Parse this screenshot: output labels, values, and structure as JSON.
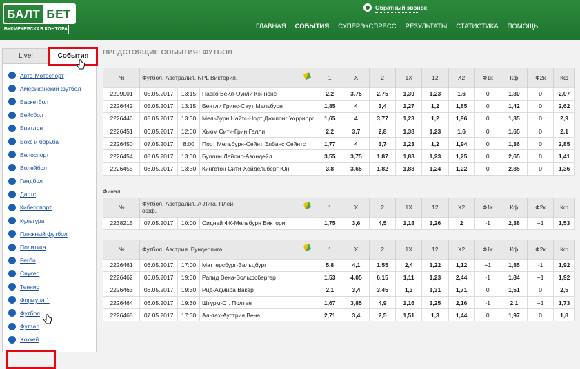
{
  "brand": {
    "logo_left": "БАЛТ",
    "logo_right": "БЕТ",
    "logo_sub": "БУКМЕКЕРСКАЯ КОНТОРА",
    "accent": "#1e7530",
    "highlight": "#e30613"
  },
  "header": {
    "callback_label": "Обратный звонок",
    "nav": [
      "ГЛАВНАЯ",
      "СОБЫТИЯ",
      "СУПЕРЭКСПРЕСС",
      "РЕЗУЛЬТАТЫ",
      "СТАТИСТИКА",
      "ПОМОЩЬ"
    ],
    "active_nav": "СОБЫТИЯ"
  },
  "sidebar": {
    "tabs": [
      "Live!",
      "События"
    ],
    "active_tab": "События",
    "sports": [
      "Авто-Мотоспорт",
      "Американский футбол",
      "Баскетбол",
      "Бейсбол",
      "Биатлон",
      "Бокс и борьба",
      "Велоспорт",
      "Волейбол",
      "Гандбол",
      "Дартс",
      "Киберспорт",
      "Культура",
      "Пляжный футбол",
      "Политика",
      "Регби",
      "Снукер",
      "Теннис",
      "Формула 1",
      "Футбол",
      "Футзал",
      "Хоккей"
    ],
    "selected_sport": "Футбол"
  },
  "main": {
    "heading": "ПРЕДСТОЯЩИЕ СОБЫТИЯ: ФУТБОЛ",
    "columns": [
      "№",
      "1",
      "X",
      "2",
      "1X",
      "12",
      "X2",
      "Ф1к",
      "Кф",
      "Ф2к",
      "Кф"
    ],
    "groups": [
      {
        "prefix": "",
        "league": "Футбол. Австралия. NPL Виктория.",
        "rows": [
          [
            "2209001",
            "05.05.2017",
            "13:15",
            "Паско Вейл-Оукли Кэннонс",
            "2,2",
            "3,75",
            "2,75",
            "1,39",
            "1,23",
            "1,6",
            "0",
            "1,80",
            "0",
            "2,07"
          ],
          [
            "2226442",
            "05.05.2017",
            "13:15",
            "Бентли Гринс-Саут Мельбурн",
            "1,85",
            "4",
            "3,4",
            "1,27",
            "1,2",
            "1,85",
            "0",
            "1,42",
            "0",
            "2,62"
          ],
          [
            "2226446",
            "05.05.2017",
            "13:30",
            "Мельбурн Найтс-Норт Джилонг Уорриорс",
            "1,65",
            "4",
            "3,77",
            "1,23",
            "1,2",
            "1,96",
            "0",
            "1,35",
            "0",
            "2,9"
          ],
          [
            "2226451",
            "06.05.2017",
            "12:00",
            "Хьюм Сити-Грин Галли",
            "2,2",
            "3,7",
            "2,8",
            "1,38",
            "1,23",
            "1,6",
            "0",
            "1,65",
            "0",
            "2,1"
          ],
          [
            "2226450",
            "07.05.2017",
            "8:00",
            "Порт Мельбурн-Сейнт Элбанс Сейнтс",
            "1,77",
            "4",
            "3,7",
            "1,23",
            "1,2",
            "1,94",
            "0",
            "1,36",
            "0",
            "2,85"
          ],
          [
            "2226454",
            "08.05.2017",
            "13:30",
            "Буллин Лайонс-Авондейл",
            "3,55",
            "3,75",
            "1,87",
            "1,83",
            "1,23",
            "1,25",
            "0",
            "2,65",
            "0",
            "1,41"
          ],
          [
            "2226455",
            "08.05.2017",
            "13:30",
            "Кингстон Сити-Хейдельберг Юн.",
            "3,8",
            "3,65",
            "1,82",
            "1,88",
            "1,24",
            "1,22",
            "0",
            "2,85",
            "0",
            "1,36"
          ]
        ]
      },
      {
        "prefix": "Финал",
        "league": "Футбол. Австралия. А-Лига. Плей-офф.",
        "rows": [
          [
            "2238215",
            "07.05.2017",
            "10:00",
            "Сидней ФК-Мельбурн Виктори",
            "1,75",
            "3,6",
            "4,5",
            "1,18",
            "1,26",
            "2",
            "-1",
            "2,38",
            "+1",
            "1,53"
          ]
        ]
      },
      {
        "prefix": "",
        "league": "Футбол. Австрия. Бундеслига.",
        "rows": [
          [
            "2226461",
            "06.05.2017",
            "17:00",
            "Маттерсбург-Зальцбург",
            "5,8",
            "4,1",
            "1,55",
            "2,4",
            "1,22",
            "1,12",
            "+1",
            "1,85",
            "-1",
            "1,92"
          ],
          [
            "2226462",
            "06.05.2017",
            "19:30",
            "Рапид Вена-Вольфсбергер",
            "1,53",
            "4,05",
            "6,15",
            "1,11",
            "1,23",
            "2,44",
            "-1",
            "1,84",
            "+1",
            "1,92"
          ],
          [
            "2226463",
            "06.05.2017",
            "19:30",
            "Рид-Адмира Вакер",
            "2,1",
            "3,4",
            "3,45",
            "1,3",
            "1,31",
            "1,71",
            "0",
            "1,51",
            "0",
            "2,5"
          ],
          [
            "2226464",
            "06.05.2017",
            "19:30",
            "Штурм-Ст. Полтен",
            "1,67",
            "3,85",
            "4,9",
            "1,16",
            "1,25",
            "2,16",
            "-1",
            "2,1",
            "+1",
            "1,73"
          ],
          [
            "2226465",
            "07.05.2017",
            "17:30",
            "Альтах-Аустрия Вена",
            "2,71",
            "3,4",
            "2,5",
            "1,51",
            "1,3",
            "1,44",
            "0",
            "1,97",
            "0",
            "1,8"
          ]
        ]
      }
    ]
  }
}
